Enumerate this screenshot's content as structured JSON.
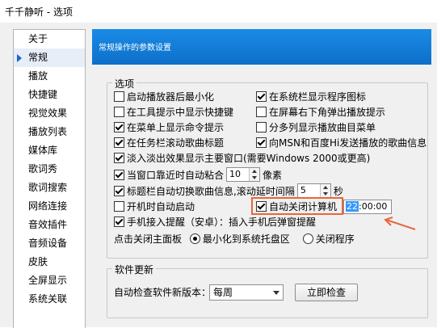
{
  "window": {
    "title": "千千静听 - 选项"
  },
  "sidebar": {
    "items": [
      {
        "label": "关于"
      },
      {
        "label": "常规"
      },
      {
        "label": "播放"
      },
      {
        "label": "快捷键"
      },
      {
        "label": "视觉效果"
      },
      {
        "label": "播放列表"
      },
      {
        "label": "媒体库"
      },
      {
        "label": "歌词秀"
      },
      {
        "label": "歌词搜索"
      },
      {
        "label": "网络连接"
      },
      {
        "label": "音效插件"
      },
      {
        "label": "音频设备"
      },
      {
        "label": "皮肤"
      },
      {
        "label": "全屏显示"
      },
      {
        "label": "系统关联"
      }
    ],
    "active_index": 1
  },
  "header": {
    "banner_text": "常规操作的参数设置"
  },
  "options": {
    "legend": "选项",
    "minimize_on_start": "启动播放器后最小化",
    "show_tray_icon": "在系统栏显示程序图标",
    "show_shortcut_in_tooltip": "在工具提示中显示快捷键",
    "show_popup_bottom_right": "在屏幕右下角弹出播放提示",
    "show_commands_in_menu": "在菜单上显示命令提示",
    "submenu_by_list": "分多列显示播放曲目菜单",
    "scroll_title_taskbar": "在任务栏滚动歌曲标题",
    "send_to_msn": "向MSN和百度Hi发送播放的歌曲信息",
    "fade_main_window": "淡入淡出效果显示主要窗口(需要Windows 2000或更高)",
    "snap_label": "当窗口靠近时自动粘合",
    "snap_value": "10",
    "snap_unit": "像素",
    "title_switch_label": "标题栏自动切换歌曲信息,滚动延时间隔",
    "title_switch_value": "5",
    "title_switch_unit": "秒",
    "autostart": "开机时自动启动",
    "auto_shutdown": "自动关闭计算机",
    "shutdown_time_hh": "22",
    "shutdown_time_rest": ":00:00",
    "phone_reminder": "手机接入提醒（安卓）：插入手机后弹窗提醒",
    "close_panel_label": "点击关闭主面板",
    "close_min_tray": "最小化到系统托盘区",
    "close_exit": "关闭程序"
  },
  "update": {
    "legend": "软件更新",
    "label": "自动检查软件新版本：",
    "frequency": "每周",
    "check_now": "立即检查"
  },
  "colors": {
    "annotation": "#e8663a",
    "banner": "#0d6fc9"
  }
}
